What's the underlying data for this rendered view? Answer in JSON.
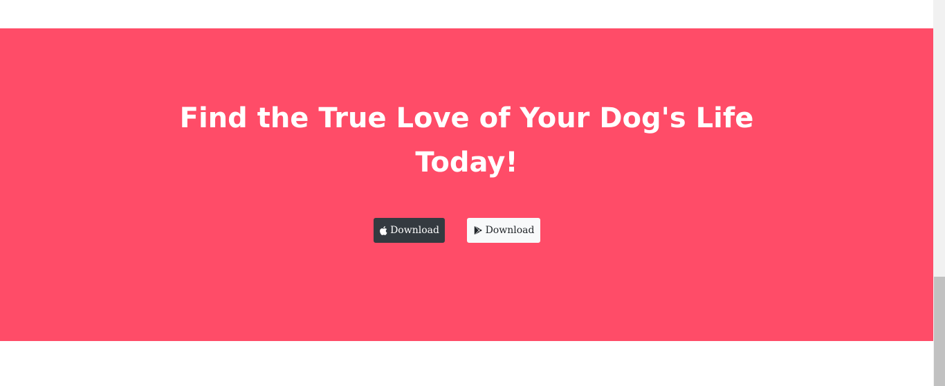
{
  "cta": {
    "title_line1": "Find the True Love of Your Dog's Life",
    "title_line2": "Today!",
    "background_color": "#ff4c68",
    "apple_button": {
      "label": "Download",
      "icon": "apple-icon"
    },
    "play_button": {
      "label": "Download",
      "icon": "google-play-icon"
    }
  }
}
